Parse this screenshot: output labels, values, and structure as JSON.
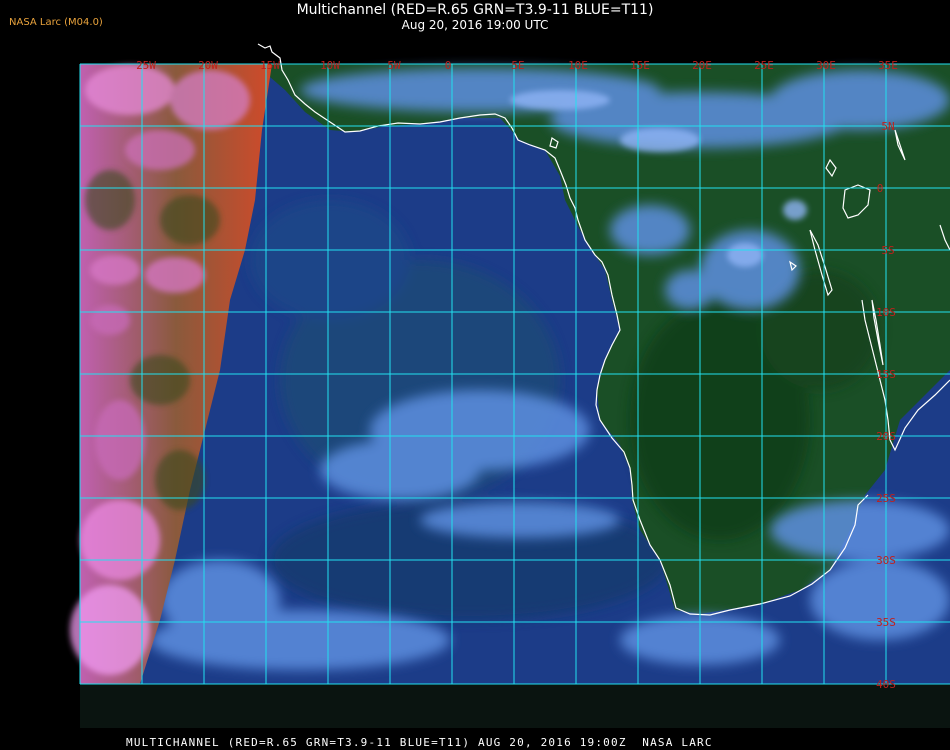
{
  "header": {
    "credit": "NASA Larc (M04.0)",
    "title": "Multichannel (RED=R.65 GRN=T3.9-11 BLUE=T11)",
    "subtitle": "Aug 20, 2016 19:00 UTC"
  },
  "footer": {
    "caption": "MULTICHANNEL (RED=R.65 GRN=T3.9-11 BLUE=T11) AUG 20, 2016 19:00Z  NASA LARC"
  },
  "map": {
    "longitude_labels": [
      "25W",
      "20W",
      "15W",
      "10W",
      "5W",
      "0",
      "5E",
      "10E",
      "15E",
      "20E",
      "25E",
      "30E",
      "35E"
    ],
    "latitude_labels": [
      "5N",
      "0",
      "5S",
      "10S",
      "15S",
      "20S",
      "25S",
      "30S",
      "35S",
      "40S"
    ],
    "colors": {
      "grid": "#22e0f0",
      "label": "#c0201c",
      "coastline": "#ffffff",
      "ocean": "#1a3f8c",
      "land": "#17501c",
      "cloud": "#7aa8f0",
      "terminator_cloud": "#e070c8"
    }
  }
}
